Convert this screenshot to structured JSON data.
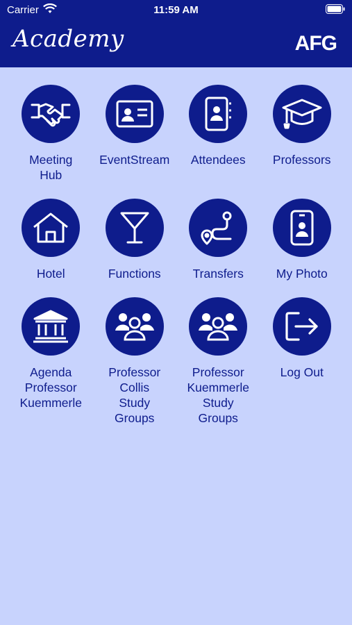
{
  "status_bar": {
    "carrier": "Carrier",
    "time": "11:59 AM"
  },
  "header": {
    "logo_left": "Academy",
    "logo_right": "AFG"
  },
  "tiles": [
    {
      "label": "Meeting\nHub",
      "icon": "handshake-icon"
    },
    {
      "label": "EventStream",
      "icon": "id-card-icon"
    },
    {
      "label": "Attendees",
      "icon": "contact-book-icon"
    },
    {
      "label": "Professors",
      "icon": "graduation-cap-icon"
    },
    {
      "label": "Hotel",
      "icon": "home-icon"
    },
    {
      "label": "Functions",
      "icon": "cocktail-glass-icon"
    },
    {
      "label": "Transfers",
      "icon": "route-icon"
    },
    {
      "label": "My Photo",
      "icon": "phone-portrait-icon"
    },
    {
      "label": "Agenda\nProfessor\nKuemmerle",
      "icon": "institution-icon"
    },
    {
      "label": "Professor\nCollis\nStudy\nGroups",
      "icon": "group-icon"
    },
    {
      "label": "Professor\nKuemmerle\nStudy\nGroups",
      "icon": "group-icon"
    },
    {
      "label": "Log Out",
      "icon": "logout-icon"
    }
  ],
  "colors": {
    "brand": "#0e1c8c",
    "background": "#c8d3fd"
  }
}
